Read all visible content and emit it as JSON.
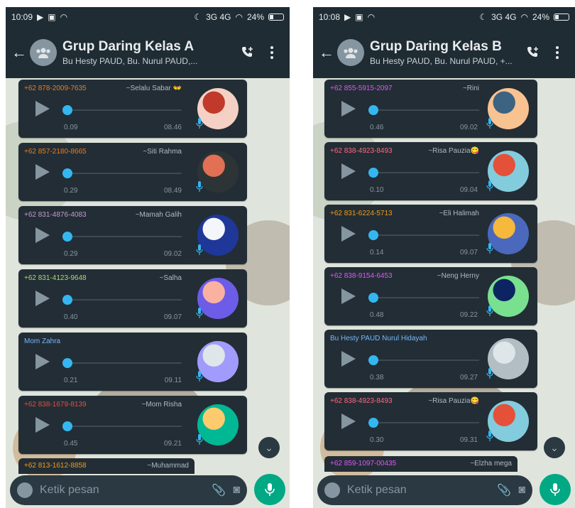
{
  "colors": {
    "bar": "#1f2c34",
    "bubble": "#232d35",
    "accent": "#00a884",
    "knob": "#34b7f1"
  },
  "panels": [
    {
      "status": {
        "time": "10:09",
        "signal": "3G 4G",
        "battery": "24%"
      },
      "header": {
        "title": "Grup Daring Kelas A",
        "members": "Bu Hesty PAUD, Bu. Nurul PAUD,..."
      },
      "messages": [
        {
          "phone": "+62 878-2009-7635",
          "name": "~Selalu Sabar 👐",
          "duration": "0.09",
          "time": "08.46",
          "color": "#e67e22"
        },
        {
          "phone": "+62 857-2180-8665",
          "name": "~Siti Rahma",
          "duration": "0.29",
          "time": "08.49",
          "color": "#e67e22"
        },
        {
          "phone": "+62 831-4876-4083",
          "name": "~Mamah Galih",
          "duration": "0.29",
          "time": "09.02",
          "color": "#c39bd3"
        },
        {
          "phone": "+62 831-4123-9648",
          "name": "~Salha",
          "duration": "0.40",
          "time": "09.07",
          "color": "#a9dc76"
        },
        {
          "phone": "Mom Zahra",
          "name": "",
          "duration": "0.21",
          "time": "09.11",
          "color": "#74b9ff"
        },
        {
          "phone": "+62 838-1679-8139",
          "name": "~Mom Risha",
          "duration": "0.45",
          "time": "09.21",
          "color": "#e74c3c"
        }
      ],
      "partial": {
        "phone": "+62 813-1612-8858",
        "name": "~Muhammad",
        "color": "#f39c12"
      },
      "composer": {
        "placeholder": "Ketik pesan"
      }
    },
    {
      "status": {
        "time": "10:08",
        "signal": "3G 4G",
        "battery": "24%"
      },
      "header": {
        "title": "Grup Daring Kelas B",
        "members": "Bu Hesty PAUD, Bu. Nurul PAUD, +..."
      },
      "messages": [
        {
          "phone": "+62 855-5915-2097",
          "name": "~Rini",
          "duration": "0.46",
          "time": "09.02",
          "color": "#e056fd"
        },
        {
          "phone": "+62 838-4923-8493",
          "name": "~Risa Pauzia😋",
          "duration": "0.10",
          "time": "09.04",
          "color": "#ff6b81"
        },
        {
          "phone": "+62 831-6224-5713",
          "name": "~Eli Halimah",
          "duration": "0.14",
          "time": "09.07",
          "color": "#f39c12"
        },
        {
          "phone": "+62 838-9154-6453",
          "name": "~Neng Herny",
          "duration": "0.48",
          "time": "09.22",
          "color": "#e056fd"
        },
        {
          "phone": "Bu Hesty PAUD Nurul Hidayah",
          "name": "",
          "duration": "0.38",
          "time": "09.27",
          "color": "#74b9ff"
        },
        {
          "phone": "+62 838-4923-8493",
          "name": "~Risa Pauzia😋",
          "duration": "0.30",
          "time": "09.31",
          "color": "#ff6b81"
        }
      ],
      "partial": {
        "phone": "+62 859-1097-00435",
        "name": "~Elzha mega",
        "color": "#e056fd"
      },
      "composer": {
        "placeholder": "Ketik pesan"
      }
    }
  ]
}
